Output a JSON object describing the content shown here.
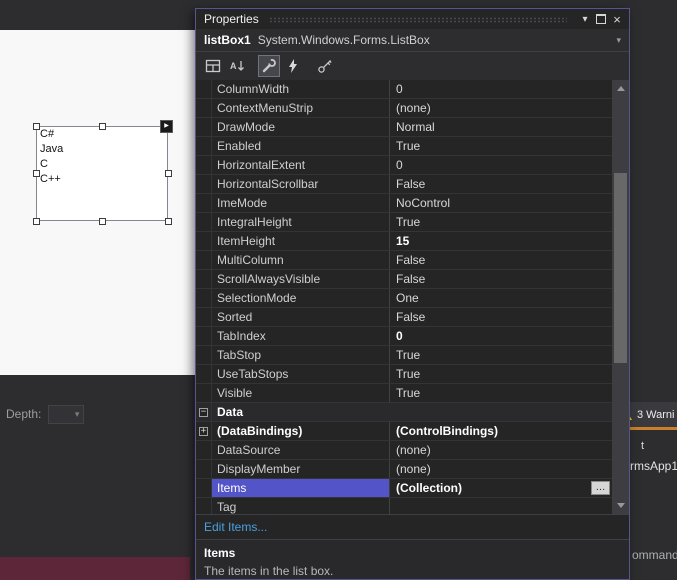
{
  "colors": {
    "accent": "#5254c8",
    "window-border": "#56568e",
    "link": "#4aa0e0",
    "warning": "#f2c811",
    "orange-line": "#c8802a",
    "maroon": "#5e2639"
  },
  "icons": {
    "menu": "▾",
    "close": "×",
    "dropdown": "▾",
    "smart_tag": "▶",
    "collapse": "−",
    "expand": "+",
    "ellipsis": "…"
  },
  "properties_panel": {
    "title": "Properties",
    "object_selector": {
      "name": "listBox1",
      "type": "System.Windows.Forms.ListBox"
    },
    "toolbar": {
      "buttons": [
        "categorized",
        "alphabetical",
        "properties",
        "events",
        "property-pages"
      ],
      "selected": "properties"
    },
    "grid": {
      "rows": [
        {
          "name": "ColumnWidth",
          "value": "0"
        },
        {
          "name": "ContextMenuStrip",
          "value": "(none)"
        },
        {
          "name": "DrawMode",
          "value": "Normal"
        },
        {
          "name": "Enabled",
          "value": "True"
        },
        {
          "name": "HorizontalExtent",
          "value": "0"
        },
        {
          "name": "HorizontalScrollbar",
          "value": "False"
        },
        {
          "name": "ImeMode",
          "value": "NoControl"
        },
        {
          "name": "IntegralHeight",
          "value": "True"
        },
        {
          "name": "ItemHeight",
          "value": "15",
          "value_bold": true
        },
        {
          "name": "MultiColumn",
          "value": "False"
        },
        {
          "name": "ScrollAlwaysVisible",
          "value": "False"
        },
        {
          "name": "SelectionMode",
          "value": "One"
        },
        {
          "name": "Sorted",
          "value": "False"
        },
        {
          "name": "TabIndex",
          "value": "0",
          "value_bold": true
        },
        {
          "name": "TabStop",
          "value": "True"
        },
        {
          "name": "UseTabStops",
          "value": "True"
        },
        {
          "name": "Visible",
          "value": "True"
        },
        {
          "name": "Data",
          "type": "category",
          "icon": "minus",
          "name_bold": true
        },
        {
          "name": "(DataBindings)",
          "value": "(ControlBindings)",
          "icon": "plus",
          "name_bold": true,
          "value_bold": true
        },
        {
          "name": "DataSource",
          "value": "(none)"
        },
        {
          "name": "DisplayMember",
          "value": "(none)"
        },
        {
          "name": "Items",
          "value": "(Collection)",
          "selected": true,
          "value_bold": true,
          "ellipsis": true
        },
        {
          "name": "Tag",
          "value": ""
        }
      ]
    },
    "edit_items_link": "Edit Items...",
    "description": {
      "title": "Items",
      "text": "The items in the list box."
    }
  },
  "designer": {
    "listbox": {
      "items": [
        "C#",
        "Java",
        "C",
        "C++"
      ]
    }
  },
  "background": {
    "depth_label": "Depth:",
    "warnings_label": "3 Warni",
    "fragments": {
      "f1": "t",
      "f2": "rmsApp1",
      "f3": "ommand"
    }
  }
}
